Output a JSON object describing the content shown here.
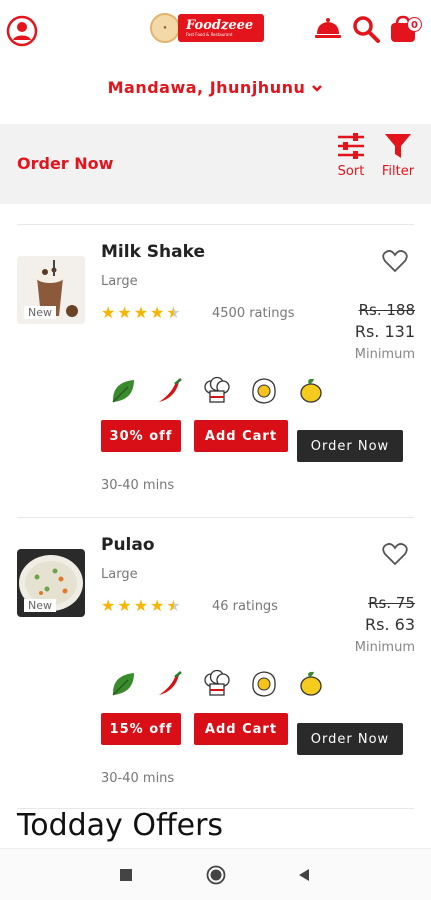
{
  "header": {
    "logo_text": "Foodzeee",
    "logo_sub": "Fast Food & Restaurant",
    "cart_count": "0",
    "icons": [
      "user-icon",
      "bell-icon",
      "search-icon",
      "cart-icon"
    ]
  },
  "location": {
    "label": "Mandawa, Jhunjhunu"
  },
  "toolbar": {
    "title": "Order Now",
    "sort_label": "Sort",
    "filter_label": "Filter"
  },
  "items": [
    {
      "name": "Milk Shake",
      "size": "Large",
      "rating": 4.5,
      "ratings_text": "4500 ratings",
      "old_price": "Rs. 188",
      "new_price": "Rs. 131",
      "min_label": "Minimum",
      "tag": "New",
      "discount_label": "30% off",
      "cart_label": "Add Cart",
      "order_label": "Order Now",
      "time": "30-40 mins"
    },
    {
      "name": "Pulao",
      "size": "Large",
      "rating": 4.5,
      "ratings_text": "46 ratings",
      "old_price": "Rs. 75",
      "new_price": "Rs. 63",
      "min_label": "Minimum",
      "tag": "New",
      "discount_label": "15% off",
      "cart_label": "Add Cart",
      "order_label": "Order Now",
      "time": "30-40 mins"
    }
  ],
  "offers": {
    "title": "Todday Offers"
  },
  "colors": {
    "accent": "#e3141b",
    "dark_button": "#2a2a2a",
    "star": "#f7b500"
  }
}
